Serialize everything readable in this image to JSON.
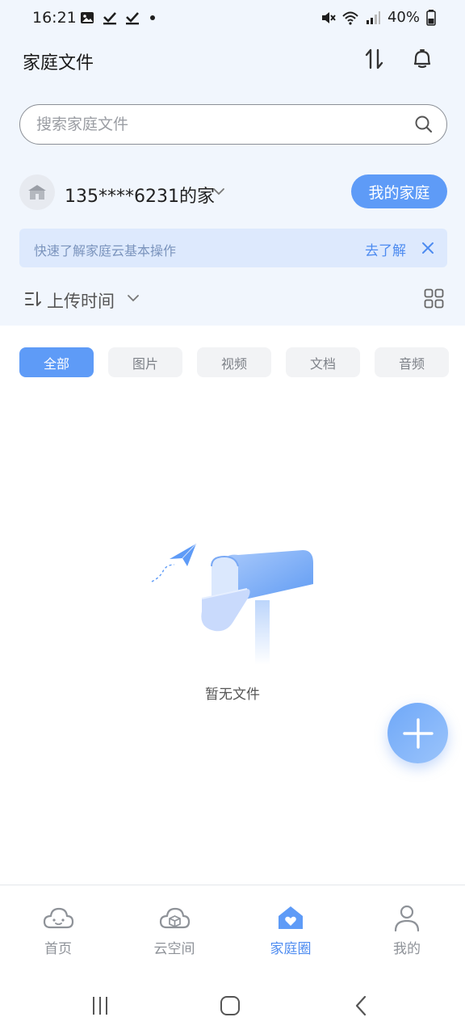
{
  "status_bar": {
    "time": "16:21",
    "battery": "40%",
    "icons_left": [
      "image-icon",
      "check-icon",
      "check-icon",
      "dot-icon"
    ],
    "icons_right": [
      "mute-icon",
      "wifi-icon",
      "signal-icon",
      "battery-icon"
    ]
  },
  "header": {
    "title": "家庭文件",
    "icons": [
      "transfer-icon",
      "bell-icon"
    ]
  },
  "search": {
    "placeholder": "搜索家庭文件"
  },
  "family": {
    "name": "135****6231的家",
    "my_family_button": "我的家庭"
  },
  "tip": {
    "text": "快速了解家庭云基本操作",
    "link": "去了解"
  },
  "sort": {
    "label": "上传时间"
  },
  "tabs": [
    {
      "label": "全部",
      "active": true
    },
    {
      "label": "图片",
      "active": false
    },
    {
      "label": "视频",
      "active": false
    },
    {
      "label": "文档",
      "active": false
    },
    {
      "label": "音频",
      "active": false
    }
  ],
  "empty_state": {
    "text": "暂无文件"
  },
  "bottom_nav": [
    {
      "label": "首页",
      "icon": "cloud-face-icon",
      "active": false
    },
    {
      "label": "云空间",
      "icon": "cloud-box-icon",
      "active": false
    },
    {
      "label": "家庭圈",
      "icon": "home-heart-icon",
      "active": true
    },
    {
      "label": "我的",
      "icon": "person-icon",
      "active": false
    }
  ],
  "colors": {
    "accent": "#5e9bf7",
    "top_background": "#f1f6fd",
    "tip_background": "#dde9fd",
    "link": "#4d8bf0"
  }
}
